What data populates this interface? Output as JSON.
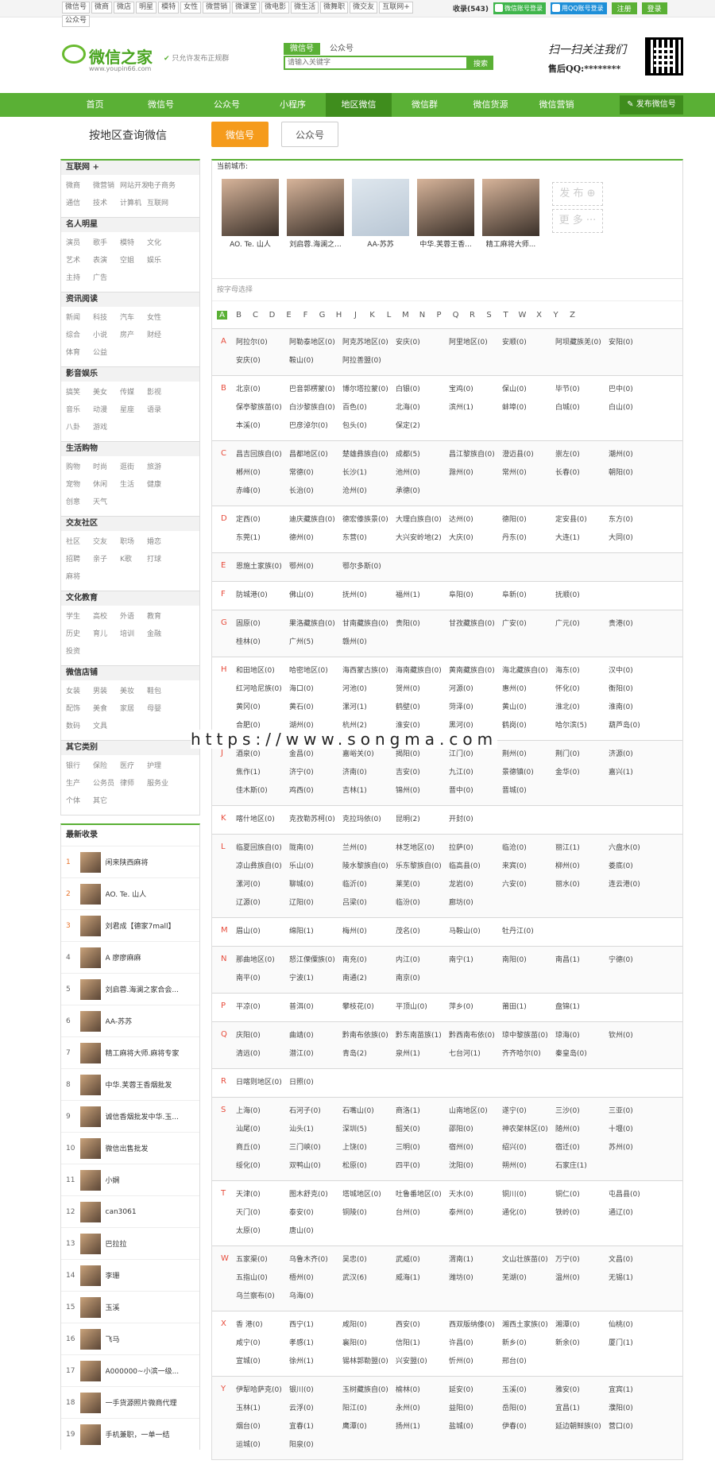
{
  "topbar": {
    "nav": [
      "微信号",
      "微商",
      "微店",
      "明星",
      "模特",
      "女性",
      "微营销",
      "微课堂",
      "微电影",
      "微生活",
      "微舞职",
      "微交友",
      "互联网+",
      "公众号"
    ],
    "collect_label": "收录(543)",
    "wechat_login": "微信账号登录",
    "qq_login": "用QQ账号登录",
    "register": "注册",
    "login": "登录"
  },
  "header": {
    "logo_name": "微信之家",
    "logo_url": "www.youpin66.com",
    "slogan": "只允许发布正规群",
    "search_tabs": [
      "微信号",
      "公众号"
    ],
    "search_placeholder": "请输入关键字",
    "search_button": "搜索",
    "follow_line1": "扫一扫关注我们",
    "follow_line2": "售后QQ:********"
  },
  "mainnav": {
    "items": [
      "首页",
      "微信号",
      "公众号",
      "小程序",
      "地区微信",
      "微信群",
      "微信货源",
      "微信营销"
    ],
    "publish": "发布微信号"
  },
  "page": {
    "title": "按地区查询微信",
    "type_tabs": [
      "微信号",
      "公众号"
    ]
  },
  "sidebar": {
    "categories": [
      {
        "title": "互联网 +",
        "tags": [
          "微商",
          "微营销",
          "网站开发",
          "电子商务",
          "通信",
          "技术",
          "计算机",
          "互联网"
        ]
      },
      {
        "title": "名人明星",
        "tags": [
          "演员",
          "歌手",
          "模特",
          "文化",
          "艺术",
          "表演",
          "空姐",
          "娱乐",
          "主持",
          "广告"
        ]
      },
      {
        "title": "资讯阅读",
        "tags": [
          "新闻",
          "科技",
          "汽车",
          "女性",
          "综合",
          "小说",
          "房产",
          "财经",
          "体育",
          "公益"
        ]
      },
      {
        "title": "影音娱乐",
        "tags": [
          "搞笑",
          "美女",
          "传媒",
          "影视",
          "音乐",
          "动漫",
          "星座",
          "语录",
          "八卦",
          "游戏"
        ]
      },
      {
        "title": "生活购物",
        "tags": [
          "购物",
          "时尚",
          "逛街",
          "旅游",
          "宠物",
          "休闲",
          "生活",
          "健康",
          "创意",
          "天气"
        ]
      },
      {
        "title": "交友社区",
        "tags": [
          "社区",
          "交友",
          "职场",
          "婚恋",
          "招聘",
          "亲子",
          "K歌",
          "打球",
          "麻将"
        ]
      },
      {
        "title": "文化教育",
        "tags": [
          "学生",
          "高校",
          "外语",
          "教育",
          "历史",
          "育儿",
          "培训",
          "金融",
          "投资"
        ]
      },
      {
        "title": "微信店铺",
        "tags": [
          "女装",
          "男装",
          "美妆",
          "鞋包",
          "配饰",
          "美食",
          "家居",
          "母婴",
          "数码",
          "文具"
        ]
      },
      {
        "title": "其它类别",
        "tags": [
          "银行",
          "保险",
          "医疗",
          "护理",
          "生产",
          "公务员",
          "律师",
          "服务业",
          "个体",
          "其它"
        ]
      }
    ],
    "latest_title": "最新收录",
    "latest": [
      {
        "no": "1",
        "name": "闲来陕西麻将"
      },
      {
        "no": "2",
        "name": "AO. Te. 山人"
      },
      {
        "no": "3",
        "name": "刘君成【德家7mall】"
      },
      {
        "no": "4",
        "name": "A 廖廖麻麻"
      },
      {
        "no": "5",
        "name": "刘启蓉.海澜之家合会..."
      },
      {
        "no": "6",
        "name": "AA-苏苏"
      },
      {
        "no": "7",
        "name": "精工麻将大师.麻将专家"
      },
      {
        "no": "8",
        "name": "中华.芙蓉王香烟批发"
      },
      {
        "no": "9",
        "name": "诚信香烟批发中华.玉..."
      },
      {
        "no": "10",
        "name": "微信出售批发"
      },
      {
        "no": "11",
        "name": "小娴"
      },
      {
        "no": "12",
        "name": "can3061"
      },
      {
        "no": "13",
        "name": "巴拉拉"
      },
      {
        "no": "14",
        "name": "李珊"
      },
      {
        "no": "15",
        "name": "玉溪"
      },
      {
        "no": "16",
        "name": "飞马"
      },
      {
        "no": "17",
        "name": "A000000~小滨一级..."
      },
      {
        "no": "18",
        "name": "一手货源照片微商代理"
      },
      {
        "no": "19",
        "name": "手机兼职，一单一结"
      }
    ]
  },
  "content": {
    "current_city": "当前城市:",
    "avatars": [
      "AO. Te. 山人",
      "刘启蓉.海澜之...",
      "AA-苏苏",
      "中华.芙蓉王香...",
      "精工麻将大师..."
    ],
    "side_publish": "发 布 ⊕",
    "side_more": "更 多 ···",
    "alpha_title": "按字母选择",
    "letters": [
      "A",
      "B",
      "C",
      "D",
      "E",
      "F",
      "G",
      "H",
      "J",
      "K",
      "L",
      "M",
      "N",
      "P",
      "Q",
      "R",
      "S",
      "T",
      "W",
      "X",
      "Y",
      "Z"
    ],
    "groups": [
      {
        "L": "A",
        "c": [
          "阿拉尔(0)",
          "阿勒泰地区(0)",
          "阿克苏地区(0)",
          "安庆(0)",
          "阿里地区(0)",
          "安顺(0)",
          "阿坝藏族羌(0)",
          "安阳(0)",
          "安庆(0)",
          "鞍山(0)",
          "阿拉善盟(0)"
        ]
      },
      {
        "L": "B",
        "c": [
          "北京(0)",
          "巴音郭楞蒙(0)",
          "博尔塔拉蒙(0)",
          "白银(0)",
          "宝鸡(0)",
          "保山(0)",
          "毕节(0)",
          "巴中(0)",
          "保亭黎族苗(0)",
          "白沙黎族自(0)",
          "百色(0)",
          "北海(0)",
          "滨州(1)",
          "蚌埠(0)",
          "白城(0)",
          "白山(0)",
          "本溪(0)",
          "巴彦淖尔(0)",
          "包头(0)",
          "保定(2)"
        ]
      },
      {
        "L": "C",
        "c": [
          "昌吉回族自(0)",
          "昌都地区(0)",
          "楚雄彝族自(0)",
          "成都(5)",
          "昌江黎族自(0)",
          "澄迈县(0)",
          "崇左(0)",
          "潮州(0)",
          "郴州(0)",
          "常德(0)",
          "长沙(1)",
          "池州(0)",
          "滁州(0)",
          "常州(0)",
          "长春(0)",
          "朝阳(0)",
          "赤峰(0)",
          "长治(0)",
          "沧州(0)",
          "承德(0)"
        ]
      },
      {
        "L": "D",
        "c": [
          "定西(0)",
          "迪庆藏族自(0)",
          "德宏傣族景(0)",
          "大理白族自(0)",
          "达州(0)",
          "德阳(0)",
          "定安县(0)",
          "东方(0)",
          "东莞(1)",
          "德州(0)",
          "东营(0)",
          "大兴安岭地(2)",
          "大庆(0)",
          "丹东(0)",
          "大连(1)",
          "大同(0)"
        ]
      },
      {
        "L": "E",
        "c": [
          "恩施土家族(0)",
          "鄂州(0)",
          "鄂尔多斯(0)"
        ]
      },
      {
        "L": "F",
        "c": [
          "防城港(0)",
          "佛山(0)",
          "抚州(0)",
          "福州(1)",
          "阜阳(0)",
          "阜新(0)",
          "抚顺(0)"
        ]
      },
      {
        "L": "G",
        "c": [
          "固原(0)",
          "果洛藏族自(0)",
          "甘南藏族自(0)",
          "贵阳(0)",
          "甘孜藏族自(0)",
          "广安(0)",
          "广元(0)",
          "贵港(0)",
          "桂林(0)",
          "广州(5)",
          "赣州(0)"
        ]
      },
      {
        "L": "H",
        "c": [
          "和田地区(0)",
          "哈密地区(0)",
          "海西蒙古族(0)",
          "海南藏族自(0)",
          "黄南藏族自(0)",
          "海北藏族自(0)",
          "海东(0)",
          "汉中(0)",
          "红河哈尼族(0)",
          "海口(0)",
          "河池(0)",
          "贺州(0)",
          "河源(0)",
          "惠州(0)",
          "怀化(0)",
          "衡阳(0)",
          "黄冈(0)",
          "黄石(0)",
          "漯河(1)",
          "鹤壁(0)",
          "菏泽(0)",
          "黄山(0)",
          "淮北(0)",
          "淮南(0)",
          "合肥(0)",
          "湖州(0)",
          "杭州(2)",
          "淮安(0)",
          "黑河(0)",
          "鹤岗(0)",
          "哈尔滨(5)",
          "葫芦岛(0)"
        ]
      },
      {
        "L": "J",
        "c": [
          "酒泉(0)",
          "金昌(0)",
          "嘉峪关(0)",
          "揭阳(0)",
          "江门(0)",
          "荆州(0)",
          "荆门(0)",
          "济源(0)",
          "焦作(1)",
          "济宁(0)",
          "济南(0)",
          "吉安(0)",
          "九江(0)",
          "景德镇(0)",
          "金华(0)",
          "嘉兴(1)",
          "佳木斯(0)",
          "鸡西(0)",
          "吉林(1)",
          "锦州(0)",
          "晋中(0)",
          "晋城(0)"
        ]
      },
      {
        "L": "K",
        "c": [
          "喀什地区(0)",
          "克孜勒苏柯(0)",
          "克拉玛依(0)",
          "昆明(2)",
          "开封(0)"
        ]
      },
      {
        "L": "L",
        "c": [
          "临夏回族自(0)",
          "陇南(0)",
          "兰州(0)",
          "林芝地区(0)",
          "拉萨(0)",
          "临沧(0)",
          "丽江(1)",
          "六盘水(0)",
          "凉山彝族自(0)",
          "乐山(0)",
          "陵水黎族自(0)",
          "乐东黎族自(0)",
          "临高县(0)",
          "来宾(0)",
          "柳州(0)",
          "娄底(0)",
          "漯河(0)",
          "聊城(0)",
          "临沂(0)",
          "莱芜(0)",
          "龙岩(0)",
          "六安(0)",
          "丽水(0)",
          "连云港(0)",
          "辽源(0)",
          "辽阳(0)",
          "吕梁(0)",
          "临汾(0)",
          "廊坊(0)"
        ]
      },
      {
        "L": "M",
        "c": [
          "眉山(0)",
          "绵阳(1)",
          "梅州(0)",
          "茂名(0)",
          "马鞍山(0)",
          "牡丹江(0)"
        ]
      },
      {
        "L": "N",
        "c": [
          "那曲地区(0)",
          "怒江傈僳族(0)",
          "南充(0)",
          "内江(0)",
          "南宁(1)",
          "南阳(0)",
          "南昌(1)",
          "宁德(0)",
          "南平(0)",
          "宁波(1)",
          "南通(2)",
          "南京(0)"
        ]
      },
      {
        "L": "P",
        "c": [
          "平凉(0)",
          "普洱(0)",
          "攀枝花(0)",
          "平顶山(0)",
          "萍乡(0)",
          "莆田(1)",
          "盘锦(1)"
        ]
      },
      {
        "L": "Q",
        "c": [
          "庆阳(0)",
          "曲靖(0)",
          "黔南布依族(0)",
          "黔东南苗族(1)",
          "黔西南布依(0)",
          "琼中黎族苗(0)",
          "琼海(0)",
          "钦州(0)",
          "清远(0)",
          "潜江(0)",
          "青岛(2)",
          "泉州(1)",
          "七台河(1)",
          "齐齐哈尔(0)",
          "秦皇岛(0)"
        ]
      },
      {
        "L": "R",
        "c": [
          "日喀则地区(0)",
          "日照(0)"
        ]
      },
      {
        "L": "S",
        "c": [
          "上海(0)",
          "石河子(0)",
          "石嘴山(0)",
          "商洛(1)",
          "山南地区(0)",
          "遂宁(0)",
          "三沙(0)",
          "三亚(0)",
          "汕尾(0)",
          "汕头(1)",
          "深圳(5)",
          "韶关(0)",
          "邵阳(0)",
          "神农架林区(0)",
          "随州(0)",
          "十堰(0)",
          "商丘(0)",
          "三门峡(0)",
          "上饶(0)",
          "三明(0)",
          "宿州(0)",
          "绍兴(0)",
          "宿迁(0)",
          "苏州(0)",
          "绥化(0)",
          "双鸭山(0)",
          "松原(0)",
          "四平(0)",
          "沈阳(0)",
          "朔州(0)",
          "石家庄(1)"
        ]
      },
      {
        "L": "T",
        "c": [
          "天津(0)",
          "图木舒克(0)",
          "塔城地区(0)",
          "吐鲁番地区(0)",
          "天水(0)",
          "铜川(0)",
          "铜仁(0)",
          "屯昌县(0)",
          "天门(0)",
          "泰安(0)",
          "铜陵(0)",
          "台州(0)",
          "泰州(0)",
          "通化(0)",
          "铁岭(0)",
          "通辽(0)",
          "太原(0)",
          "唐山(0)"
        ]
      },
      {
        "L": "W",
        "c": [
          "五家渠(0)",
          "乌鲁木齐(0)",
          "吴忠(0)",
          "武威(0)",
          "渭南(1)",
          "文山壮族苗(0)",
          "万宁(0)",
          "文昌(0)",
          "五指山(0)",
          "梧州(0)",
          "武汉(6)",
          "威海(1)",
          "潍坊(0)",
          "芜湖(0)",
          "温州(0)",
          "无锡(1)",
          "乌兰察布(0)",
          "乌海(0)"
        ]
      },
      {
        "L": "X",
        "c": [
          "香 港(0)",
          "西宁(1)",
          "咸阳(0)",
          "西安(0)",
          "西双版纳傣(0)",
          "湘西土家族(0)",
          "湘潭(0)",
          "仙桃(0)",
          "咸宁(0)",
          "孝感(1)",
          "襄阳(0)",
          "信阳(1)",
          "许昌(0)",
          "新乡(0)",
          "新余(0)",
          "厦门(1)",
          "宣城(0)",
          "徐州(1)",
          "锡林郭勒盟(0)",
          "兴安盟(0)",
          "忻州(0)",
          "邢台(0)"
        ]
      },
      {
        "L": "Y",
        "c": [
          "伊犁哈萨克(0)",
          "银川(0)",
          "玉树藏族自(0)",
          "榆林(0)",
          "延安(0)",
          "玉溪(0)",
          "雅安(0)",
          "宜宾(1)",
          "玉林(1)",
          "云浮(0)",
          "阳江(0)",
          "永州(0)",
          "益阳(0)",
          "岳阳(0)",
          "宜昌(1)",
          "濮阳(0)",
          "烟台(0)",
          "宜春(1)",
          "鹰潭(0)",
          "扬州(1)",
          "盐城(0)",
          "伊春(0)",
          "延边朝鲜族(0)",
          "营口(0)",
          "运城(0)",
          "阳泉(0)"
        ]
      }
    ]
  },
  "watermark": "https://www.songma.com"
}
